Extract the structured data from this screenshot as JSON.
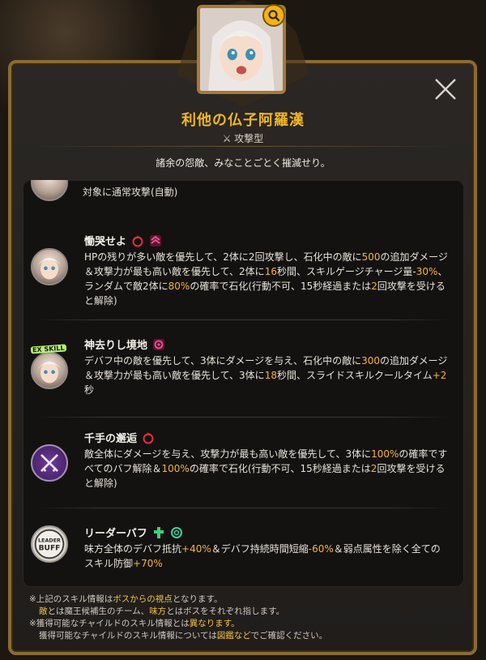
{
  "character": {
    "name": "利他の仏子阿羅漢",
    "type_label": "攻撃型",
    "quote": "諸余の怨敵、みなことごとく摧滅せり。"
  },
  "partial_skill": {
    "desc": "対象に通常攻撃(自動)"
  },
  "skills": [
    {
      "name": "慟哭せよ",
      "tags": [
        "red-drop-icon",
        "pink-chevron-icon"
      ],
      "desc_parts": [
        {
          "t": "HPの残りが多い敵を優先して、2体に2回攻撃し、石化中の敵に"
        },
        {
          "t": "500",
          "h": true
        },
        {
          "t": "の追加ダメージ＆攻撃力が最も高い敵を優先して、2体に"
        },
        {
          "t": "16",
          "h": true
        },
        {
          "t": "秒間、スキルゲージチャージ量-"
        },
        {
          "t": "30%",
          "h": true
        },
        {
          "t": "、ランダムで敵2体に"
        },
        {
          "t": "80%",
          "h": true
        },
        {
          "t": "の確率で石化(行動不可、15秒経過または"
        },
        {
          "t": "2",
          "h": true
        },
        {
          "t": "回攻撃を受けると解除)"
        }
      ]
    },
    {
      "name": "神去りし境地",
      "tags": [
        "pink-target-icon"
      ],
      "ex_tag": "EX SKILL",
      "desc_parts": [
        {
          "t": "デバフ中の敵を優先して、3体にダメージを与え、石化中の敵に"
        },
        {
          "t": "300",
          "h": true
        },
        {
          "t": "の追加ダメージ＆攻撃力が最も高い敵を優先して、3体に"
        },
        {
          "t": "18",
          "h": true
        },
        {
          "t": "秒間、スライドスキルクールタイム"
        },
        {
          "t": "+2",
          "h": true
        },
        {
          "t": "秒"
        }
      ]
    },
    {
      "name": "千手の邂逅",
      "tags": [
        "red-drop-icon"
      ],
      "desc_parts": [
        {
          "t": "敵全体にダメージを与え、攻撃力が最も高い敵を優先して、3体に"
        },
        {
          "t": "100%",
          "h": true
        },
        {
          "t": "の確率ですべてのバフ解除＆"
        },
        {
          "t": "100%",
          "h": true
        },
        {
          "t": "の確率で石化(行動不可、15秒経過または"
        },
        {
          "t": "2",
          "h": true
        },
        {
          "t": "回攻撃を受けると解除)"
        }
      ]
    },
    {
      "name": "リーダーバフ",
      "tags": [
        "green-cross-icon",
        "green-ring-icon"
      ],
      "leader_label_1": "LEADER",
      "leader_label_2": "BUFF",
      "desc_parts": [
        {
          "t": "味方全体のデバフ抵抗"
        },
        {
          "t": "+40%",
          "h": true
        },
        {
          "t": "＆デバフ持続時間短縮"
        },
        {
          "t": "-60%",
          "h": true
        },
        {
          "t": "＆弱点属性を除く全てのスキル防御"
        },
        {
          "t": "+70%",
          "h": true
        }
      ]
    }
  ],
  "footer": {
    "lines": [
      [
        {
          "t": "※上記のスキル情報は"
        },
        {
          "t": "ボスからの視点",
          "h": true
        },
        {
          "t": "となります。"
        }
      ],
      [
        {
          "t": "敵",
          "h": true
        },
        {
          "t": "とは魔王候補生のチーム、"
        },
        {
          "t": "味方",
          "h": true
        },
        {
          "t": "とはボスをそれぞれ指します。"
        }
      ],
      [
        {
          "t": "※獲得可能なチャイルドのスキル情報とは"
        },
        {
          "t": "異なります。",
          "h": true
        }
      ],
      [
        {
          "t": "獲得可能なチャイルドのスキル情報については"
        },
        {
          "t": "図鑑など",
          "h": true
        },
        {
          "t": "でご確認ください。"
        }
      ]
    ]
  },
  "colors": {
    "accent": "#f1b726",
    "highlight": "#f4b43a",
    "frame": "#8a6b34"
  }
}
